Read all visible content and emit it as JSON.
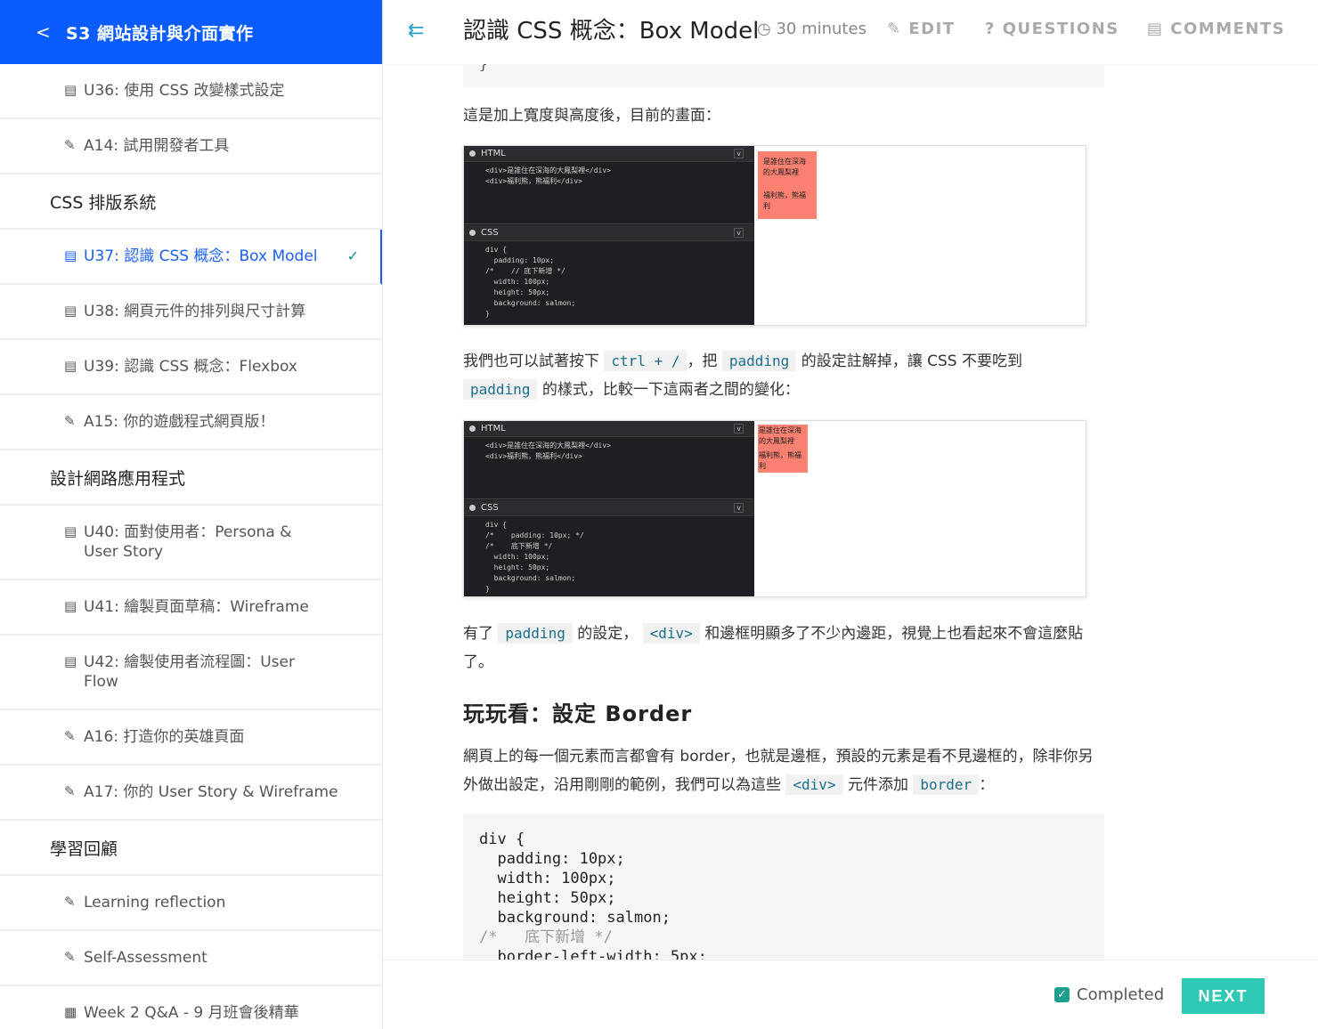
{
  "sidebar": {
    "back_icon": "chevron-left-icon",
    "course_title": "S3 網站設計與介面實作",
    "items": [
      {
        "type": "doc",
        "label": "U36: 使用 CSS 改變樣式設定"
      },
      {
        "type": "edit",
        "label": "A14: 試用開發者工具"
      },
      {
        "type": "section",
        "label": "CSS 排版系統"
      },
      {
        "type": "doc",
        "label": "U37: 認識 CSS 概念：Box Model",
        "active": true
      },
      {
        "type": "doc",
        "label": "U38: 網頁元件的排列與尺寸計算"
      },
      {
        "type": "doc",
        "label": "U39: 認識 CSS 概念：Flexbox"
      },
      {
        "type": "edit",
        "label": "A15: 你的遊戲程式網頁版！"
      },
      {
        "type": "section",
        "label": "設計網路應用程式"
      },
      {
        "type": "doc",
        "label": "U40: 面對使用者：Persona &",
        "label2": "User Story"
      },
      {
        "type": "doc",
        "label": "U41: 繪製頁面草稿：Wireframe"
      },
      {
        "type": "doc",
        "label": "U42: 繪製使用者流程圖：User",
        "label2": "Flow"
      },
      {
        "type": "edit",
        "label": "A16: 打造你的英雄頁面"
      },
      {
        "type": "edit",
        "label": "A17: 你的 User Story & Wireframe"
      },
      {
        "type": "section",
        "label": "學習回顧"
      },
      {
        "type": "edit",
        "label": "Learning reflection"
      },
      {
        "type": "edit",
        "label": "Self-Assessment"
      },
      {
        "type": "event",
        "label": "Week 2 Q&A - 9 月班會後精華"
      }
    ]
  },
  "topbar": {
    "title": "認識 CSS 概念：Box Model",
    "duration": "30 minutes",
    "edit": "EDIT",
    "questions": "QUESTIONS",
    "comments": "COMMENTS"
  },
  "content": {
    "stub_brace": "}",
    "p1": "這是加上寬度與高度後，目前的畫面：",
    "p2_a": "我們也可以試著按下",
    "p2_code1": "ctrl + /",
    "p2_b": "，把",
    "p2_code2": "padding",
    "p2_c": "的設定註解掉，讓 CSS 不要吃到",
    "p2_code3": "padding",
    "p2_d": "的樣式，比較一下這兩者之間的變化：",
    "p3_a": "有了",
    "p3_code1": "padding",
    "p3_b": "的設定，",
    "p3_code2": "<div>",
    "p3_c": "和邊框明顯多了不少內邊距，視覺上也看起來不會這麼貼了。",
    "h3": "玩玩看：設定 Border",
    "p4_a": "網頁上的每一個元素而言都會有 border，也就是邊框，預設的元素是看不見邊框的，除非你另外做出設定，沿用剛剛的範例，我們可以為這些",
    "p4_code1": "<div>",
    "p4_b": "元件添加",
    "p4_code2": "border",
    "p4_c": "：",
    "code_lines": [
      "div {",
      "  padding: 10px;",
      "  width: 100px;",
      "  height: 50px;",
      "  background: salmon;",
      "/*   底下新增 */",
      "  border-left-width: 5px;"
    ],
    "demo": {
      "html_label": "HTML",
      "css_label": "CSS",
      "html_line1": "<div>是誰住在深海的大鳳梨裡</div>",
      "html_line2": "<div>福利熊，熊福利</div>",
      "css1": [
        "div {",
        "  padding: 10px;",
        "/*    // 底下新增 */",
        "  width: 100px;",
        "  height: 50px;",
        "  background: salmon;",
        "}"
      ],
      "css2": [
        "div {",
        "/*    padding: 10px; */",
        "/*    底下新增 */",
        "  width: 100px;",
        "  height: 50px;",
        "  background: salmon;",
        "}"
      ],
      "box_line1": "是誰住在深海",
      "box_line2": "的大鳳梨裡",
      "box_line3": "福利熊，熊福",
      "box_line4": "利"
    }
  },
  "bottombar": {
    "completed": "Completed",
    "next": "NEXT"
  },
  "colors": {
    "primary": "#1a5ef2",
    "teal": "#2fc8b4",
    "salmon": "#fa8072"
  }
}
